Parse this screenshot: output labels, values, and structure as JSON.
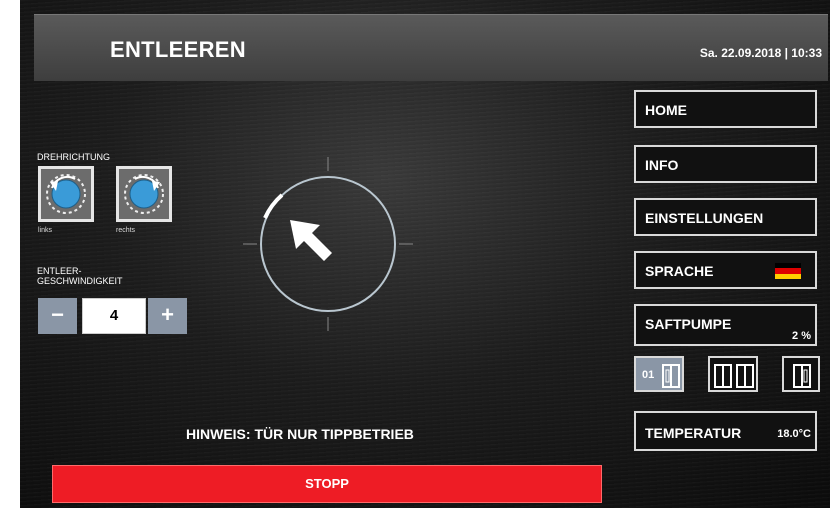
{
  "header": {
    "title": "ENTLEEREN",
    "datetime": "Sa. 22.09.2018 | 10:33"
  },
  "rotation": {
    "label": "DREHRICHTUNG",
    "left_label": "links",
    "right_label": "rechts",
    "selected": "links"
  },
  "speed": {
    "label": "ENTLEER-\nGESCHWINDIGKEIT",
    "value": "4",
    "minus": "−",
    "plus": "+"
  },
  "hint": "HINWEIS: TÜR NUR TIPPBETRIEB",
  "stop_label": "STOPP",
  "menu": {
    "home": "HOME",
    "info": "INFO",
    "settings": "EINSTELLUNGEN",
    "language": "SPRACHE",
    "juice_pump": "SAFTPUMPE",
    "juice_pump_value": "2 %",
    "temperature": "TEMPERATUR",
    "temperature_value": "18.0°C"
  },
  "pumps": {
    "active_label": "01"
  },
  "colors": {
    "stop": "#ee1c25",
    "accent": "#8a96a6",
    "flag": [
      "#000000",
      "#dd0000",
      "#ffce00"
    ]
  }
}
